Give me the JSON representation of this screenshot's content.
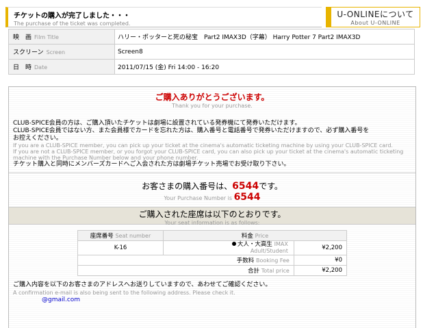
{
  "header": {
    "title": "チケットの購入が完了しました・・・",
    "subtitle": "The purchase of the ticket was completed."
  },
  "u_online": {
    "title": "U-ONLINEについて",
    "subtitle": "About U-ONLINE"
  },
  "info": {
    "film_label": "映　画",
    "film_label_en": "Film Title",
    "film_value": "ハリー・ポッターと死の秘宝　Part2 IMAX3D（字幕）  Harry Potter 7 Part2 IMAX3D",
    "screen_label": "スクリーン",
    "screen_label_en": "Screen",
    "screen_value": "Screen8",
    "date_label": "日　時",
    "date_label_en": "Date",
    "date_value": "2011/07/15 (金) Fri 14:00 - 16:20"
  },
  "thanks": {
    "jp": "ご購入ありがとうございます。",
    "en": "Thank you for your purchase."
  },
  "notice": {
    "line1_jp": "CLUB-SPICE会員の方は、ご購入頂いたチケットは劇場に設置されている発券機にて発券いただけます。",
    "line2_jp": "CLUB-SPICE会員ではない方、また会員様でカードを忘れた方は、購入番号と電話番号で発券いただけますので、必ず購入番号を",
    "line2b_jp": "お控えください。",
    "line1_en": "If you are a CLUB-SPICE member, you can pick up your ticket at the cinema's automatic ticketing machine by using your CLUB-SPICE card.",
    "line2_en": "If you are not a CLUB-SPICE member, or you forgot your CLUB-SPICE card, you can also pick up your ticket at the cinema's automatic ticketing",
    "line3_en": "machine with the Purchase Number below and your phone number.",
    "line3_jp": "チケット購入と同時にメンバーズカードへご入会された方は劇場チケット売場でお受け取り下さい。"
  },
  "purchase": {
    "prefix_jp": "お客さまの購入番号は、",
    "number": "6544",
    "suffix_jp": "です。",
    "prefix_en": "Your Purchase Number is",
    "number_en": "6544"
  },
  "seat_band": {
    "jp": "ご購入された座席は以下のとおりです。",
    "en": "Your seat information is as follows:"
  },
  "seat_table": {
    "seat_header_jp": "座席番号",
    "seat_header_en": "Seat number",
    "price_header_jp": "料金",
    "price_header_en": "Price",
    "seat": "K-16",
    "ticket_type_jp": "大人・大高生",
    "ticket_type_imax": "IMAX",
    "ticket_type_en": "Adult/Student",
    "ticket_price": "¥2,200",
    "fee_jp": "手数料",
    "fee_en": "Booking Fee",
    "fee_value": "¥0",
    "total_jp": "合計",
    "total_en": "Total price",
    "total_value": "¥2,200"
  },
  "confirm": {
    "jp": "ご購入内容を以下のお客さまのアドレスへお送りしていますので、あわせてご確認ください。",
    "en": "A confirmation e-mail is also being sent to the following address. Please check it.",
    "email": "@gmail.com"
  }
}
